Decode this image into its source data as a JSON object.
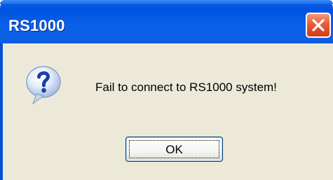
{
  "window": {
    "title": "RS1000",
    "close_icon": "close-icon"
  },
  "dialog": {
    "icon": "question-icon",
    "message": "Fail to connect to RS1000 system!",
    "ok_label": "OK"
  },
  "colors": {
    "titlebar": "#0053e1",
    "client_background": "#ece9d8",
    "close_button": "#e65c36",
    "button_border": "#003c74"
  }
}
